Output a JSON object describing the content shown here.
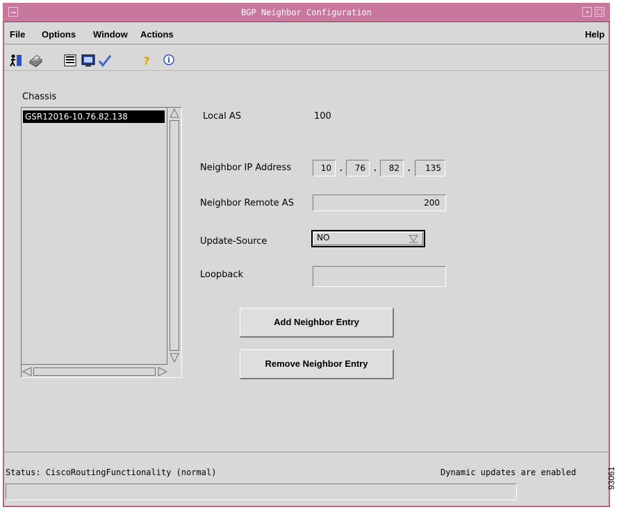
{
  "window": {
    "title": "BGP Neighbor Configuration"
  },
  "menu": {
    "file": "File",
    "options": "Options",
    "window": "Window",
    "actions": "Actions",
    "help": "Help"
  },
  "toolbar": [
    "exit-icon",
    "print-icon",
    "list-icon",
    "monitor-icon",
    "check-icon",
    "help-icon",
    "info-icon"
  ],
  "chassis": {
    "label": "Chassis",
    "items": [
      "GSR12016-10.76.82.138"
    ]
  },
  "form": {
    "local_as_label": "Local AS",
    "local_as_value": "100",
    "neighbor_ip_label": "Neighbor IP Address",
    "neighbor_ip_octets": [
      "10",
      "76",
      "82",
      "135"
    ],
    "neighbor_ip_dots": [
      ".",
      ".",
      "."
    ],
    "remote_as_label": "Neighbor Remote AS",
    "remote_as_value": "200",
    "update_source_label": "Update-Source",
    "update_source_value": "NO",
    "loopback_label": "Loopback",
    "loopback_value": ""
  },
  "buttons": {
    "add": "Add Neighbor Entry",
    "remove": "Remove Neighbor Entry"
  },
  "status": {
    "left": "Status: CiscoRoutingFunctionality (normal)",
    "right": "Dynamic updates are enabled"
  },
  "figure_id": "93061",
  "colors": {
    "titlebar": "#c8789c",
    "background": "#d8d8d8",
    "selection": "#000000"
  }
}
